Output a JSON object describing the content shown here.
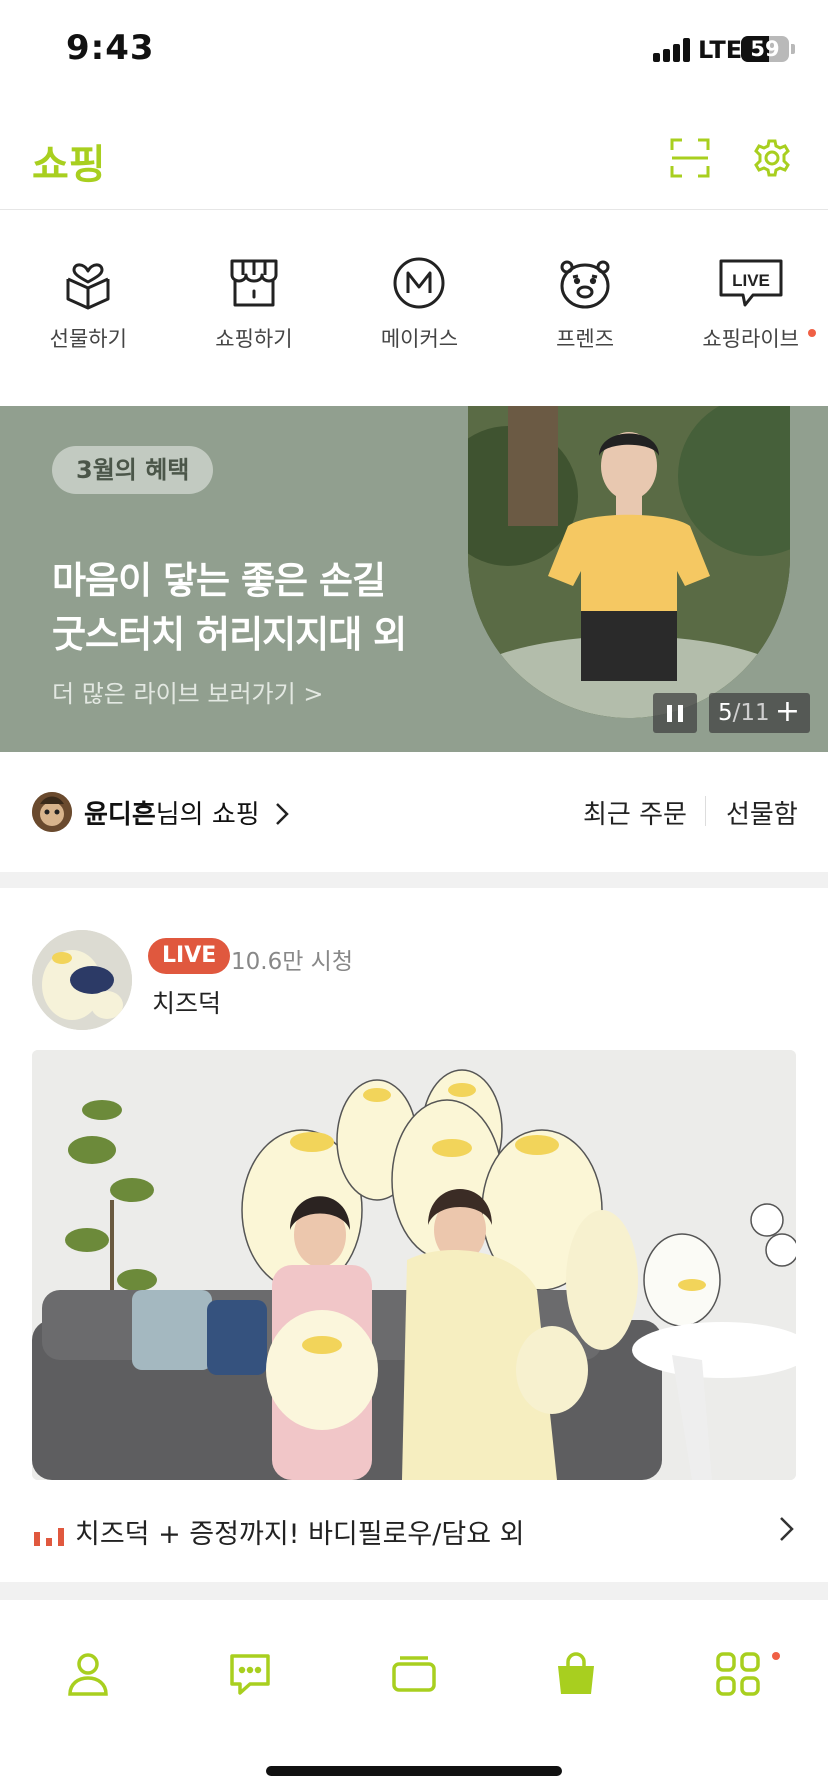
{
  "status_bar": {
    "time": "9:43",
    "network": "LTE",
    "battery": "59",
    "battery_level": 0.59
  },
  "header": {
    "title": "쇼핑",
    "icons": [
      "scan-icon",
      "gear-icon"
    ]
  },
  "categories": [
    {
      "label": "선물하기",
      "icon": "gift-icon"
    },
    {
      "label": "쇼핑하기",
      "icon": "store-icon"
    },
    {
      "label": "메이커스",
      "icon": "makers-icon"
    },
    {
      "label": "프렌즈",
      "icon": "friends-icon"
    },
    {
      "label": "쇼핑라이브",
      "icon": "live-icon",
      "has_new_dot": true
    }
  ],
  "banner": {
    "pill": "3월의 혜택",
    "title_line1": "마음이 닿는 좋은 손길",
    "title_line2": "굿스터치 허리지지대 외",
    "link": "더 많은 라이브 보러가기 >",
    "pager_current": "5",
    "pager_total": "/11",
    "background": "#919f8f"
  },
  "my_shopping": {
    "user_name": "윤디흔",
    "suffix": "님의 쇼핑",
    "recent_orders": "최근 주문",
    "gift_box": "선물함"
  },
  "live": {
    "badge": "LIVE",
    "viewers": "10.6만 시청",
    "seller": "치즈덕",
    "title": "치즈덕 + 증정까지! 바디필로우/담요 외"
  },
  "tab_bar": {
    "tabs": [
      "friends-tab",
      "chats-tab",
      "view-tab",
      "shopping-tab",
      "more-tab"
    ],
    "active": "shopping-tab",
    "accent": "#a8cf1f"
  }
}
